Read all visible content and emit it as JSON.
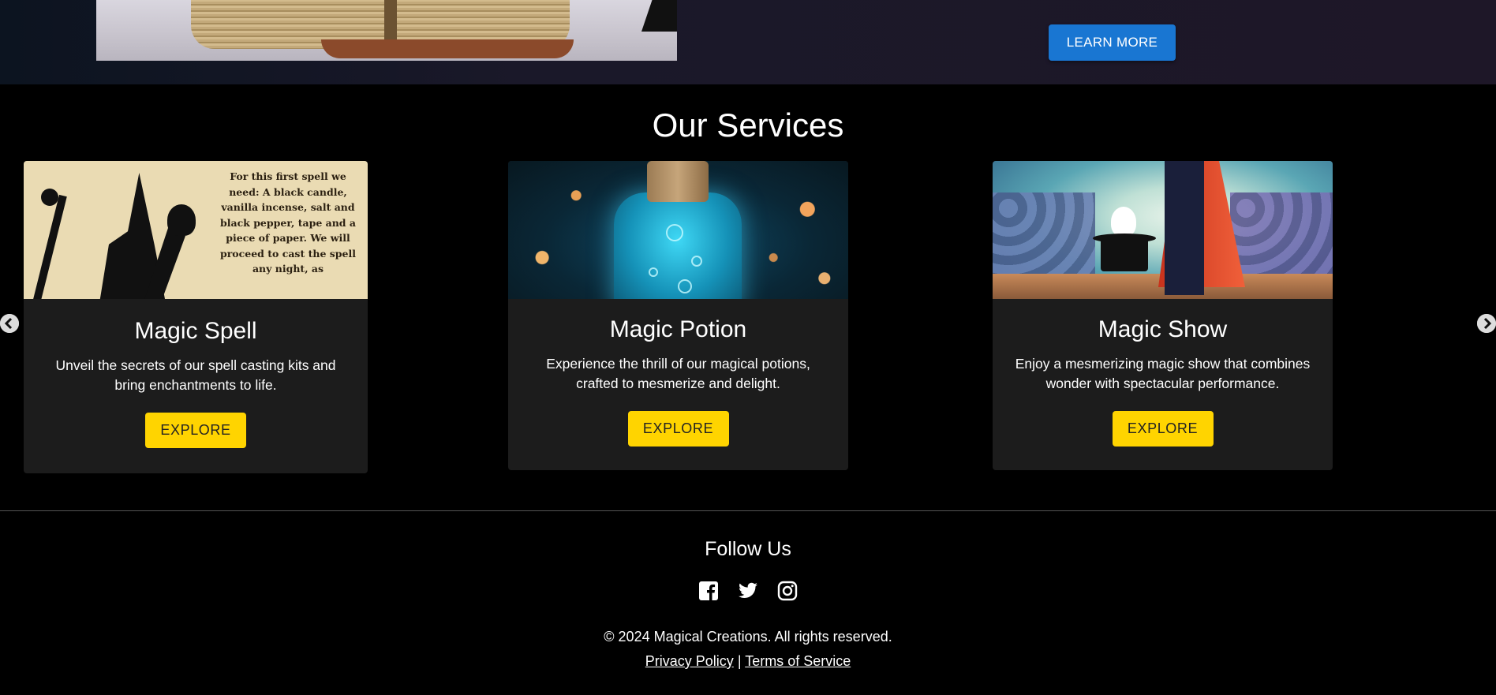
{
  "hero": {
    "learn_more_label": "LEARN MORE",
    "button_color": "#1976d2"
  },
  "services": {
    "title": "Our Services",
    "cards": [
      {
        "title": "Magic Spell",
        "description": "Unveil the secrets of our spell casting kits and bring enchantments to life.",
        "button": "EXPLORE",
        "image_text": "For this first spell we need: A black candle, vanilla incense, salt and black pepper, tape and a piece of paper. We will proceed to cast the spell any night, as"
      },
      {
        "title": "Magic Potion",
        "description": "Experience the thrill of our magical potions, crafted to mesmerize and delight.",
        "button": "EXPLORE"
      },
      {
        "title": "Magic Show",
        "description": "Enjoy a mesmerizing magic show that combines wonder with spectacular performance.",
        "button": "EXPLORE"
      }
    ],
    "explore_color": "#ffd400",
    "prev_icon": "chevron-left-icon",
    "next_icon": "chevron-right-icon"
  },
  "footer": {
    "follow_title": "Follow Us",
    "social": [
      "facebook-icon",
      "twitter-icon",
      "instagram-icon"
    ],
    "copyright": "© 2024 Magical Creations. All rights reserved.",
    "privacy": "Privacy Policy",
    "separator": "|",
    "terms": "Terms of Service"
  }
}
